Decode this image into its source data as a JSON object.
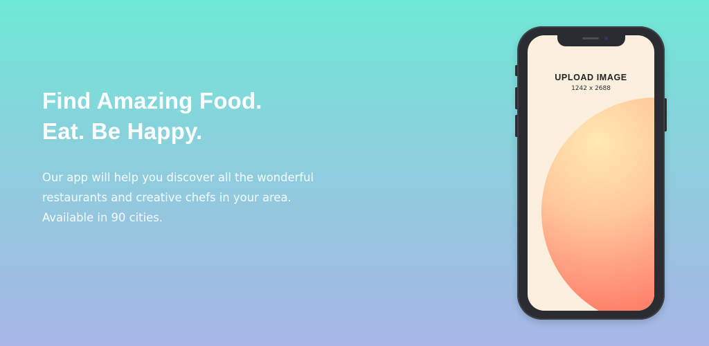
{
  "hero": {
    "headline_line1": "Find Amazing Food.",
    "headline_line2": "Eat. Be Happy.",
    "description": "Our app will help you discover all the wonderful restaurants and creative chefs in your area. Available in 90 cities."
  },
  "phone": {
    "upload_title": "UPLOAD IMAGE",
    "upload_size": "1242 x 2688"
  },
  "colors": {
    "background_top": "#6ee9d6",
    "background_bottom": "#a7b6e6",
    "phone_frame": "#2a2c31",
    "screen_bg": "#fdefdd",
    "blob_accent": "#fb6d55"
  }
}
